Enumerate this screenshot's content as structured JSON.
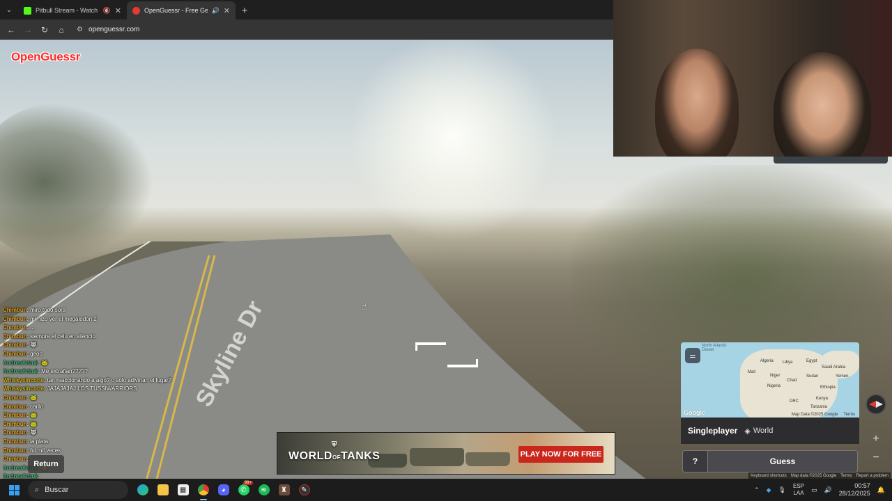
{
  "browser": {
    "tabs": [
      {
        "title": "Pitbull Stream - Watch Live",
        "favicon_color": "#53fc18",
        "active": false
      },
      {
        "title": "OpenGuessr - Free GeoGue",
        "favicon_color": "#e53935",
        "active": true
      }
    ],
    "new_tab_symbol": "+",
    "url": "openguessr.com"
  },
  "game": {
    "brand": "OpenGuessr",
    "street_label": "Skyline Dr",
    "minimap": {
      "labels": [
        "North Atlantic Ocean",
        "Algeria",
        "Libya",
        "Egypt",
        "Saudi Arabia",
        "Mali",
        "Niger",
        "Chad",
        "Sudan",
        "Yemen",
        "Nigeria",
        "Ethiopia",
        "DRC",
        "Kenya",
        "Tanzania"
      ],
      "attribution": "Map Data ©2025 Google",
      "terms": "Terms",
      "google": "Google"
    },
    "mode": "Singleplayer",
    "region": "World",
    "help_label": "?",
    "guess_label": "Guess",
    "zoom_in": "+",
    "zoom_out": "−",
    "return_label": "Return",
    "footer": [
      "Keyboard shortcuts",
      "Map data ©2025 Google",
      "Terms",
      "Report a problem"
    ]
  },
  "chat": [
    {
      "user": "Chimbun",
      "color": "#e8a317",
      "text": "miro todo sora"
    },
    {
      "user": "Chimbun",
      "color": "#e8a317",
      "text": "mi hizo ver el megalodon 2"
    },
    {
      "user": "Chimbun",
      "color": "#e8a317",
      "text": "..."
    },
    {
      "user": "Chimbun",
      "color": "#e8a317",
      "text": "siempre el celu en silencio"
    },
    {
      "user": "Chimbun",
      "color": "#e8a317",
      "text": "🐺"
    },
    {
      "user": "Chimbun",
      "color": "#e8a317",
      "text": "geoo"
    },
    {
      "user": "AndreaArbuk",
      "color": "#3cb371",
      "text": "🐸"
    },
    {
      "user": "AndreaArbuk",
      "color": "#3cb371",
      "text": "Me extrañan?????"
    },
    {
      "user": "Whiskysincorte",
      "color": "#d4b106",
      "text": "tan reaccionando a algo? o solo adivinan el lugar?"
    },
    {
      "user": "Whiskysincorte",
      "color": "#d4b106",
      "text": "JAJAJAJAJ LOS TUSSIWARRIORS"
    },
    {
      "user": "Chimbun",
      "color": "#e8a317",
      "text": "🐸"
    },
    {
      "user": "Chimbun",
      "color": "#e8a317",
      "text": "carilo"
    },
    {
      "user": "Chimbun",
      "color": "#e8a317",
      "text": "🐸"
    },
    {
      "user": "Chimbun",
      "color": "#e8a317",
      "text": "🐸"
    },
    {
      "user": "Chimbun",
      "color": "#e8a317",
      "text": "🐺"
    },
    {
      "user": "Chimbun",
      "color": "#e8a317",
      "text": "la plata"
    },
    {
      "user": "Chimbun",
      "color": "#e8a317",
      "text": "fui mil veces"
    },
    {
      "user": "Chimbun",
      "color": "#e8a317",
      "text": ""
    },
    {
      "user": "AndreaArbuk",
      "color": "#3cb371",
      "text": "🐸"
    },
    {
      "user": "AndreaArbuk",
      "color": "#3cb371",
      "text": ""
    }
  ],
  "ad": {
    "logo_line1": "WORLD",
    "logo_of": "OF",
    "logo_line2": "TANKS",
    "cta": "PLAY NOW FOR FREE"
  },
  "taskbar": {
    "search_placeholder": "Buscar",
    "badge": "99+",
    "lang_line1": "ESP",
    "lang_line2": "LAA",
    "time": "00:57",
    "date": "28/12/2025"
  }
}
